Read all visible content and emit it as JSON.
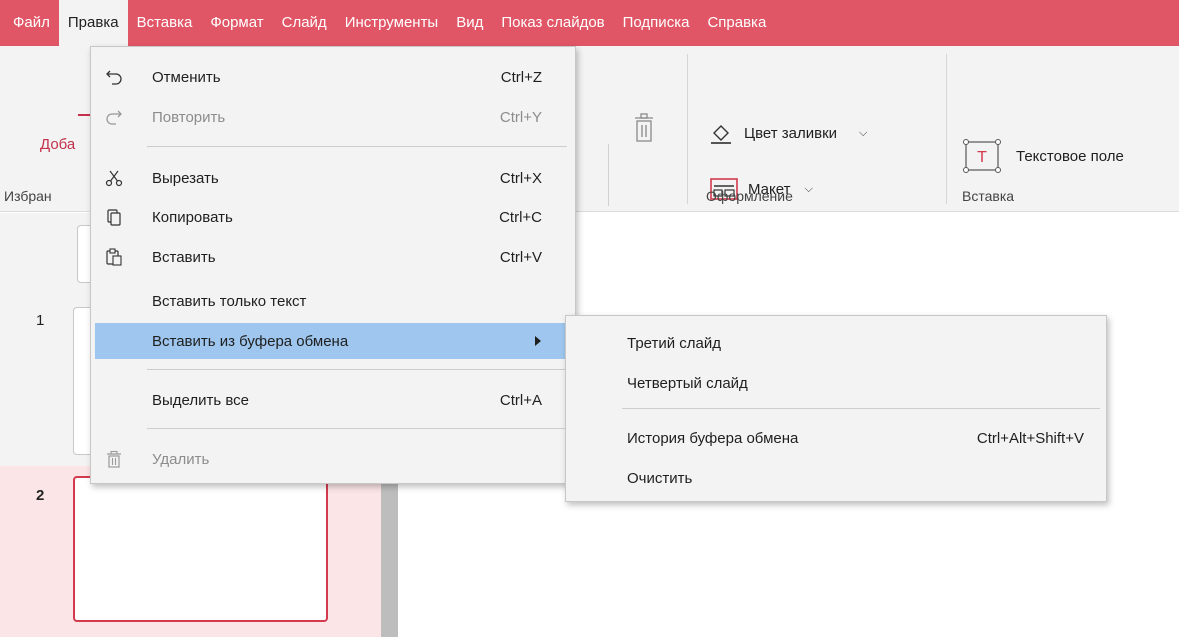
{
  "menubar": {
    "items": [
      {
        "label": "Файл"
      },
      {
        "label": "Правка"
      },
      {
        "label": "Вставка"
      },
      {
        "label": "Формат"
      },
      {
        "label": "Слайд"
      },
      {
        "label": "Инструменты"
      },
      {
        "label": "Вид"
      },
      {
        "label": "Показ слайдов"
      },
      {
        "label": "Подписка"
      },
      {
        "label": "Справка"
      }
    ],
    "active_index": 1,
    "color": "#e05666"
  },
  "ribbon": {
    "add_label_partial": "Доба",
    "group_favorites_partial": "Избран",
    "fill_color_label": "Цвет заливки",
    "layout_label": "Макет",
    "textbox_label": "Текстовое поле",
    "group_design": "Оформление",
    "group_insert": "Вставка"
  },
  "slides": {
    "numbers": [
      "1",
      "2"
    ],
    "selected": "2",
    "accent": "#d33a4e"
  },
  "edit_menu": {
    "undo": {
      "label": "Отменить",
      "shortcut": "Ctrl+Z",
      "icon": "undo-icon"
    },
    "redo": {
      "label": "Повторить",
      "shortcut": "Ctrl+Y",
      "icon": "redo-icon",
      "disabled": true
    },
    "cut": {
      "label": "Вырезать",
      "shortcut": "Ctrl+X",
      "icon": "scissors-icon"
    },
    "copy": {
      "label": "Копировать",
      "shortcut": "Ctrl+C",
      "icon": "copy-icon"
    },
    "paste": {
      "label": "Вставить",
      "shortcut": "Ctrl+V",
      "icon": "paste-icon"
    },
    "paste_text": {
      "label": "Вставить только текст"
    },
    "paste_from_clipboard": {
      "label": "Вставить из буфера обмена",
      "highlighted": true
    },
    "select_all": {
      "label": "Выделить все",
      "shortcut": "Ctrl+A"
    },
    "delete": {
      "label": "Удалить",
      "icon": "trash-icon",
      "disabled": true
    },
    "highlight_color": "#9ec6ee"
  },
  "clipboard_submenu": {
    "third_slide": {
      "label": "Третий слайд"
    },
    "fourth_slide": {
      "label": "Четвертый слайд"
    },
    "history": {
      "label": "История буфера обмена",
      "shortcut": "Ctrl+Alt+Shift+V"
    },
    "clear": {
      "label": "Очистить"
    }
  }
}
